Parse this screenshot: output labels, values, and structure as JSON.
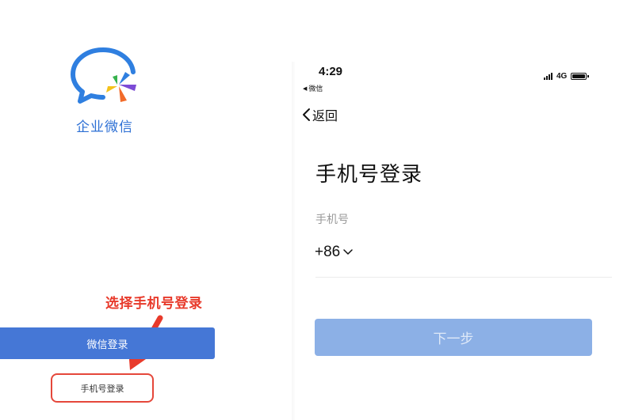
{
  "left": {
    "brand_name": "企业微信",
    "annotation": "选择手机号登录",
    "wechat_login_label": "微信登录",
    "phone_login_label": "手机号登录"
  },
  "right": {
    "status_bar": {
      "time": "4:29",
      "back_app": "微信",
      "network": "4G"
    },
    "nav": {
      "back_label": "返回"
    },
    "title": "手机号登录",
    "field_label": "手机号",
    "country_code": "+86",
    "next_label": "下一步"
  },
  "colors": {
    "primary_blue": "#4577d6",
    "disabled_blue": "#8cb0e6",
    "annotation_red": "#e83a2b"
  },
  "icons": [
    "wecom-logo",
    "annotation-arrow",
    "signal-icon",
    "battery-icon",
    "chevron-left-icon",
    "chevron-down-icon"
  ]
}
